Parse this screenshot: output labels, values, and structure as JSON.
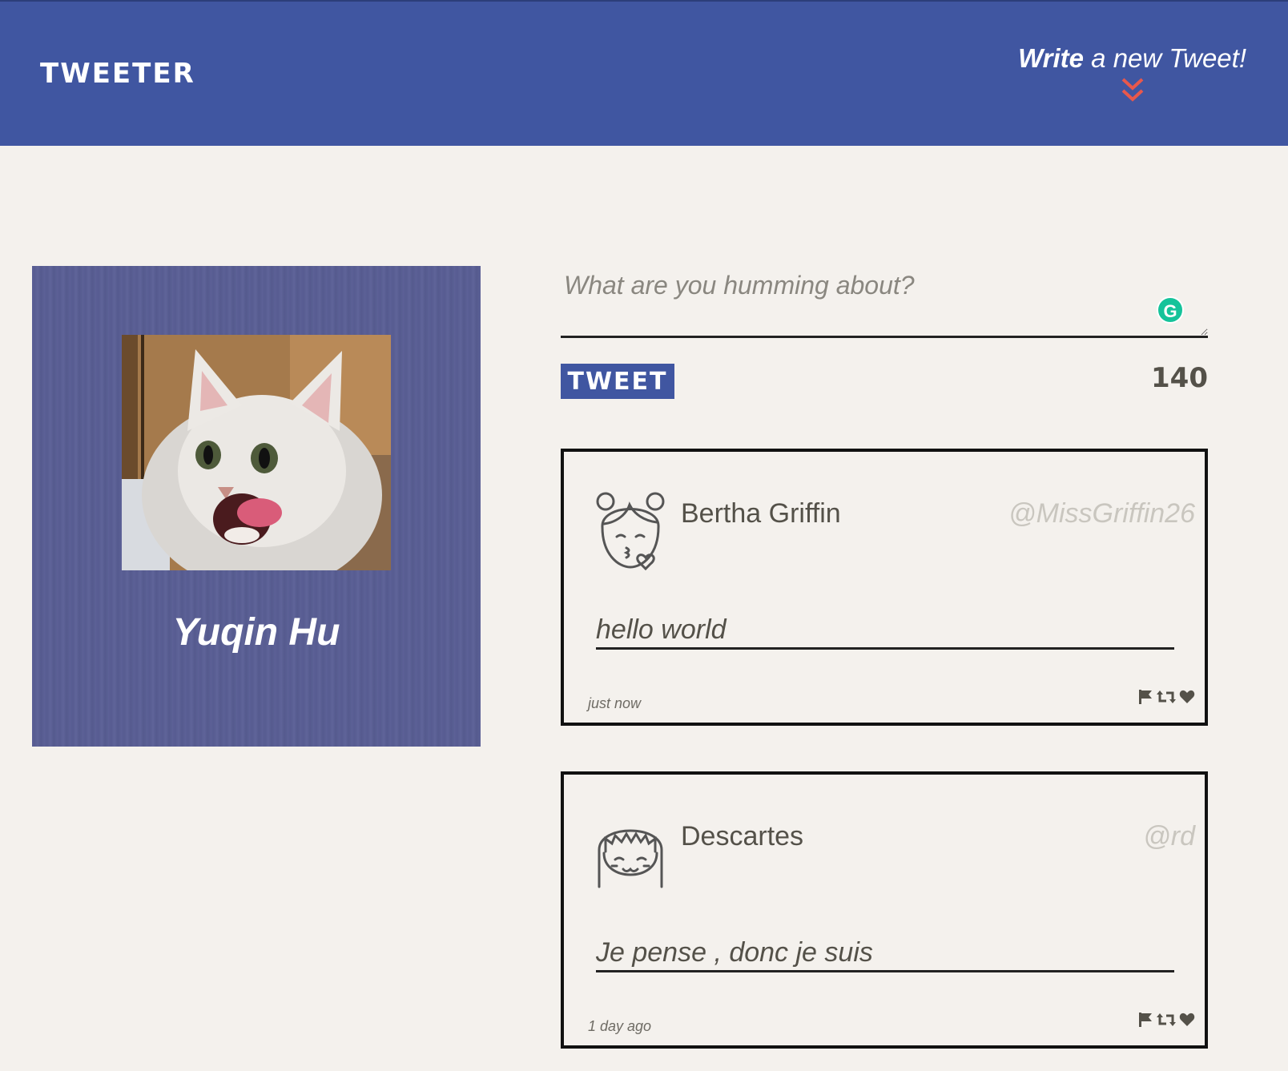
{
  "header": {
    "brand": "TWEETER",
    "compose_strong": "Write",
    "compose_rest": " a new Tweet!",
    "chevron_color": "#e8584c",
    "bar_color": "#4056a1"
  },
  "profile": {
    "name": "Yuqin Hu",
    "avatar": "cat-photo"
  },
  "composer": {
    "placeholder": "What are you humming about?",
    "button_label": "TWEET",
    "counter": "140",
    "assistant_icon": "G"
  },
  "tweets": [
    {
      "author": "Bertha Griffin",
      "handle": "@MissGriffin26",
      "content": "hello world",
      "time": "just now",
      "avatar_icon": "girl-kiss-avatar-icon",
      "actions": [
        "flag-icon",
        "retweet-icon",
        "heart-icon"
      ]
    },
    {
      "author": "Descartes",
      "handle": "@rd",
      "content": "Je pense , donc je suis",
      "time": "1 day ago",
      "avatar_icon": "girl-smile-avatar-icon",
      "actions": [
        "flag-icon",
        "retweet-icon",
        "heart-icon"
      ]
    }
  ]
}
